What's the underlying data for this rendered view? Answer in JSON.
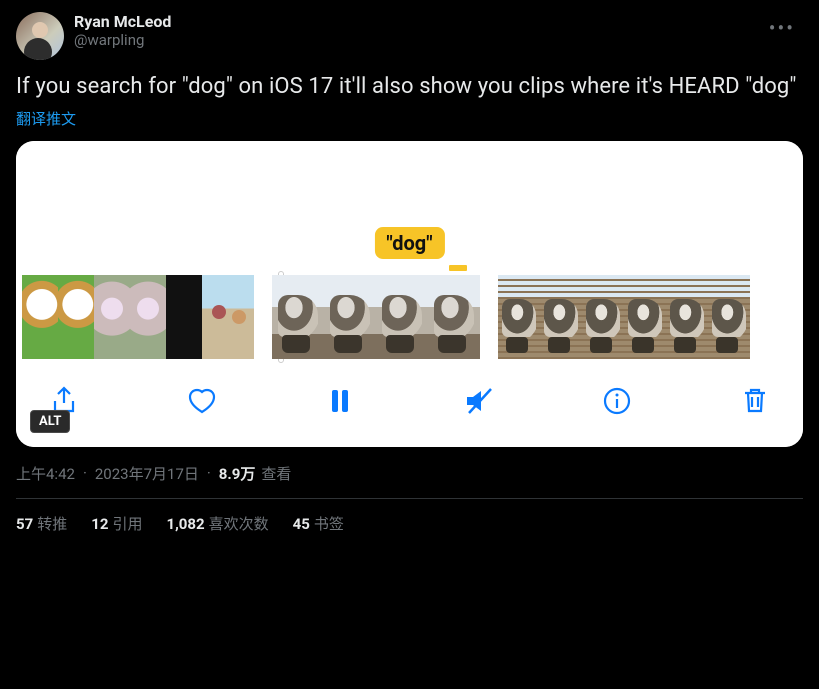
{
  "author": {
    "display_name": "Ryan McLeod",
    "handle": "@warpling"
  },
  "tweet_text": "If you search for \"dog\" on iOS 17 it'll also show you clips where it's HEARD \"dog\"",
  "translate_label": "翻译推文",
  "media": {
    "caption_text": "\"dog\"",
    "alt_badge": "ALT",
    "toolbar_icons": [
      "share",
      "heart",
      "pause",
      "mute",
      "info",
      "trash"
    ]
  },
  "meta": {
    "time": "上午4:42",
    "date": "2023年7月17日",
    "views_value": "8.9万",
    "views_label": "查看"
  },
  "stats": {
    "retweets": {
      "value": "57",
      "label": "转推"
    },
    "quotes": {
      "value": "12",
      "label": "引用"
    },
    "likes": {
      "value": "1,082",
      "label": "喜欢次数"
    },
    "bookmarks": {
      "value": "45",
      "label": "书签"
    }
  }
}
